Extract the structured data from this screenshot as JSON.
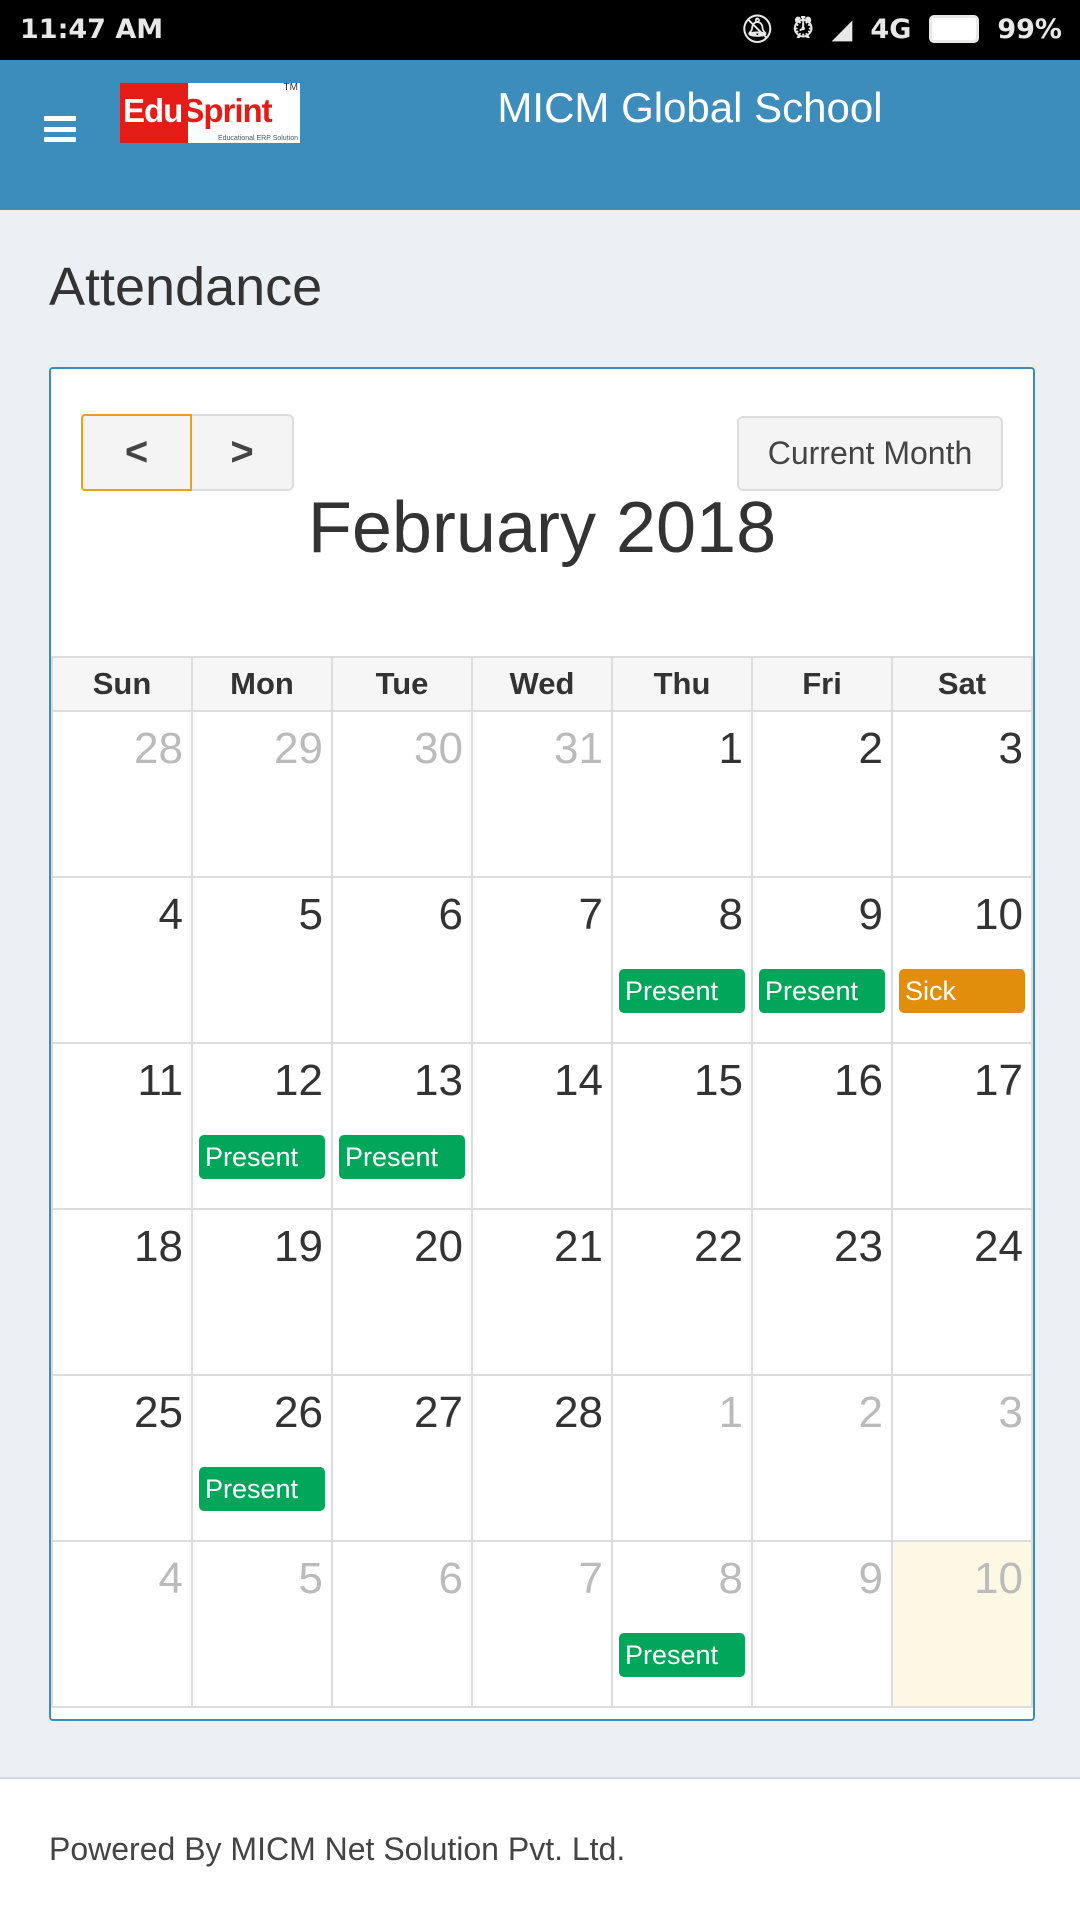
{
  "status_bar": {
    "time": "11:47 AM",
    "network": "4G",
    "battery": "99%"
  },
  "header": {
    "logo_text_a": "Edu",
    "logo_text_b": "Sprint",
    "logo_tm": "TM",
    "logo_tagline": "Educational ERP Solution",
    "school_name": "MICM Global School"
  },
  "page": {
    "title": "Attendance"
  },
  "calendar": {
    "prev_label": "<",
    "next_label": ">",
    "current_month_label": "Current Month",
    "month_title": "February 2018",
    "weekdays": [
      "Sun",
      "Mon",
      "Tue",
      "Wed",
      "Thu",
      "Fri",
      "Sat"
    ],
    "event_colors": {
      "Present": "#00a65a",
      "Sick": "#e08e0b"
    },
    "weeks": [
      [
        {
          "day": "28",
          "other": true
        },
        {
          "day": "29",
          "other": true
        },
        {
          "day": "30",
          "other": true
        },
        {
          "day": "31",
          "other": true
        },
        {
          "day": "1"
        },
        {
          "day": "2"
        },
        {
          "day": "3"
        }
      ],
      [
        {
          "day": "4"
        },
        {
          "day": "5"
        },
        {
          "day": "6"
        },
        {
          "day": "7"
        },
        {
          "day": "8",
          "event": "Present"
        },
        {
          "day": "9",
          "event": "Present"
        },
        {
          "day": "10",
          "event": "Sick"
        }
      ],
      [
        {
          "day": "11"
        },
        {
          "day": "12",
          "event": "Present"
        },
        {
          "day": "13",
          "event": "Present"
        },
        {
          "day": "14"
        },
        {
          "day": "15"
        },
        {
          "day": "16"
        },
        {
          "day": "17"
        }
      ],
      [
        {
          "day": "18"
        },
        {
          "day": "19"
        },
        {
          "day": "20"
        },
        {
          "day": "21"
        },
        {
          "day": "22"
        },
        {
          "day": "23"
        },
        {
          "day": "24"
        }
      ],
      [
        {
          "day": "25"
        },
        {
          "day": "26",
          "event": "Present"
        },
        {
          "day": "27"
        },
        {
          "day": "28"
        },
        {
          "day": "1",
          "other": true
        },
        {
          "day": "2",
          "other": true
        },
        {
          "day": "3",
          "other": true
        }
      ],
      [
        {
          "day": "4",
          "other": true
        },
        {
          "day": "5",
          "other": true
        },
        {
          "day": "6",
          "other": true
        },
        {
          "day": "7",
          "other": true
        },
        {
          "day": "8",
          "other": true,
          "event": "Present"
        },
        {
          "day": "9",
          "other": true
        },
        {
          "day": "10",
          "other": true,
          "today": true
        }
      ]
    ]
  },
  "footer": {
    "text": "Powered By MICM Net Solution Pvt. Ltd."
  }
}
